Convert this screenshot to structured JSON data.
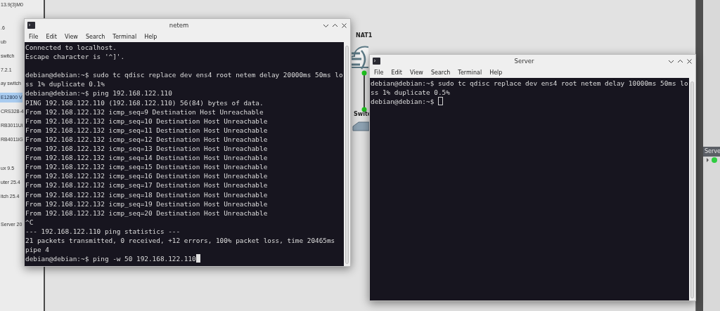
{
  "sidebar": {
    "items": [
      {
        "label": "13.9(3)M0",
        "selected": false
      },
      {
        "label": ".6",
        "selected": false
      },
      {
        "label": "ub",
        "selected": false
      },
      {
        "label": "switch",
        "selected": false
      },
      {
        "label": "7.2.1",
        "selected": false
      },
      {
        "label": "ay switch",
        "selected": false
      },
      {
        "label": "E12800 V",
        "selected": true
      },
      {
        "label": "CRS328-4",
        "selected": false
      },
      {
        "label": "RB3011Ui",
        "selected": false
      },
      {
        "label": "RB4011iG",
        "selected": false
      },
      {
        "label": "ux 9.5",
        "selected": false
      },
      {
        "label": "uter 25.4",
        "selected": false
      },
      {
        "label": "itch 25.4",
        "selected": false
      },
      {
        "label": "Server 20",
        "selected": false
      }
    ]
  },
  "canvas": {
    "nodes": [
      {
        "kind": "cloud",
        "label": "NAT1"
      },
      {
        "kind": "switch",
        "label": "Switc"
      }
    ]
  },
  "right_panel": {
    "title": "Serve"
  },
  "windows": [
    {
      "title": "netem",
      "menu": [
        "File",
        "Edit",
        "View",
        "Search",
        "Terminal",
        "Help"
      ],
      "focused": true,
      "blocks": [
        [
          "Connected to localhost.",
          "Escape character is '^]'."
        ],
        [
          "debian@debian:~$ sudo tc qdisc replace dev ens4 root netem delay 20000ms 50ms lo",
          "ss 1% duplicate 0.1%",
          "debian@debian:~$ ping 192.168.122.110",
          "PING 192.168.122.110 (192.168.122.110) 56(84) bytes of data.",
          "From 192.168.122.132 icmp_seq=9 Destination Host Unreachable",
          "From 192.168.122.132 icmp_seq=10 Destination Host Unreachable",
          "From 192.168.122.132 icmp_seq=11 Destination Host Unreachable",
          "From 192.168.122.132 icmp_seq=12 Destination Host Unreachable",
          "From 192.168.122.132 icmp_seq=13 Destination Host Unreachable",
          "From 192.168.122.132 icmp_seq=14 Destination Host Unreachable",
          "From 192.168.122.132 icmp_seq=15 Destination Host Unreachable",
          "From 192.168.122.132 icmp_seq=16 Destination Host Unreachable",
          "From 192.168.122.132 icmp_seq=17 Destination Host Unreachable",
          "From 192.168.122.132 icmp_seq=18 Destination Host Unreachable",
          "From 192.168.122.132 icmp_seq=19 Destination Host Unreachable",
          "From 192.168.122.132 icmp_seq=20 Destination Host Unreachable",
          "^C",
          "--- 192.168.122.110 ping statistics ---",
          "21 packets transmitted, 0 received, +12 errors, 100% packet loss, time 20465ms",
          "pipe 4",
          "debian@debian:~$ ping -w 50 192.168.122.110"
        ]
      ]
    },
    {
      "title": "Server",
      "menu": [
        "File",
        "Edit",
        "View",
        "Search",
        "Terminal",
        "Help"
      ],
      "focused": false,
      "blocks": [
        [
          "debian@debian:~$ sudo tc qdisc replace dev ens4 root netem delay 10000ms 50ms lo",
          "ss 1% duplicate 0.5%",
          "debian@debian:~$ "
        ]
      ]
    }
  ]
}
